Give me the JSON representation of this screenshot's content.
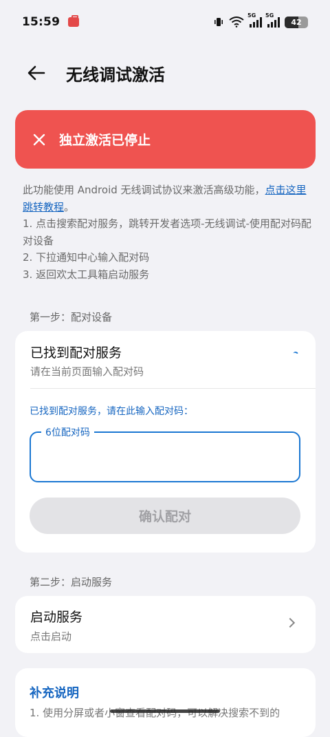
{
  "status_bar": {
    "time": "15:59",
    "network_1": "5G",
    "network_2": "5G",
    "battery": "42"
  },
  "app_bar": {
    "title": "无线调试激活"
  },
  "banner": {
    "text": "独立激活已停止",
    "color": "#ef5350"
  },
  "description": {
    "intro": "此功能使用 Android 无线调试协议来激活高级功能，",
    "link": "点击这里跳转教程",
    "intro_end": "。",
    "steps": [
      "1. 点击搜索配对服务，跳转开发者选项-无线调试-使用配对码配对设备",
      "2. 下拉通知中心输入配对码",
      "3. 返回欢太工具箱启动服务"
    ]
  },
  "step1": {
    "label": "第一步：配对设备",
    "title": "已找到配对服务",
    "subtitle": "请在当前页面输入配对码",
    "hint": "已找到配对服务，请在此输入配对码：",
    "field_label": "6位配对码",
    "field_value": "",
    "confirm_label": "确认配对"
  },
  "step2": {
    "label": "第二步：启动服务",
    "title": "启动服务",
    "subtitle": "点击启动"
  },
  "notes": {
    "title": "补充说明",
    "body": "1. 使用分屏或者小窗查看配对码，可以解决搜索不到的"
  },
  "colors": {
    "accent": "#1976d2",
    "background": "#f2f2f6"
  }
}
